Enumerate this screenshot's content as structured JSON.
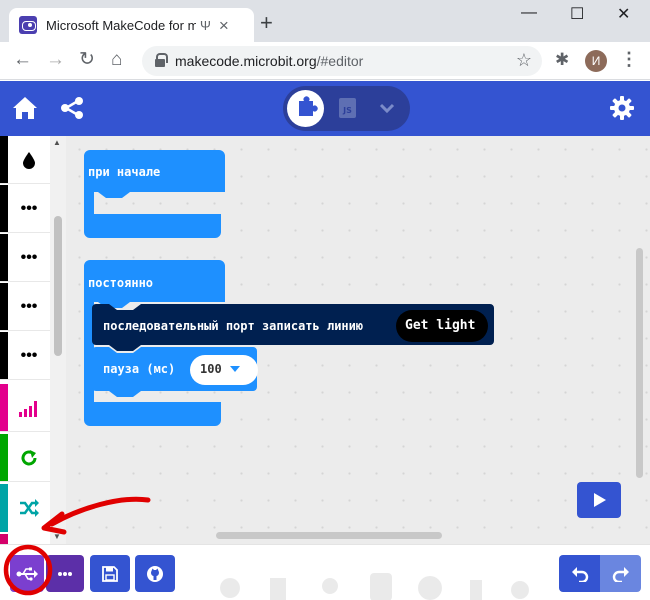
{
  "browser": {
    "tab_title": "Microsoft MakeCode for micro:bit",
    "tab_usb_glyph": "Ψ",
    "tab_close_glyph": "×",
    "new_tab_glyph": "+",
    "window_controls": {
      "minimize": "—",
      "maximize": "☐",
      "close": "✕"
    },
    "nav": {
      "back": "←",
      "forward": "→",
      "reload": "↻",
      "home": "⌂"
    },
    "url_host": "makecode.microbit.org",
    "url_path": "/#editor",
    "star_glyph": "☆",
    "extensions_glyph": "✱",
    "profile_initial": "И",
    "menu_glyph": "⋮"
  },
  "header": {
    "icons": [
      "home-icon",
      "share-icon",
      "gear-icon"
    ],
    "toggle": {
      "blocks_icon": "puzzle-icon",
      "js_label": "JS",
      "dropdown_icon": "chevron-down-icon"
    },
    "colors": {
      "header": "#3454d1",
      "toggle": "#2c3f9a"
    }
  },
  "toolbox": {
    "items": [
      {
        "icon": "drop-icon",
        "glyph": "●",
        "color": "#000000"
      },
      {
        "icon": "more-icon",
        "glyph": "•••",
        "color": "#000000"
      },
      {
        "icon": "more-icon",
        "glyph": "•••",
        "color": "#000000"
      },
      {
        "icon": "more-icon",
        "glyph": "•••",
        "color": "#000000"
      },
      {
        "icon": "more-icon",
        "glyph": "•••",
        "color": "#000000"
      },
      {
        "icon": "signal-icon",
        "glyph": "",
        "color": "#e3008c"
      },
      {
        "icon": "loop-icon",
        "glyph": "",
        "color": "#00a600"
      },
      {
        "icon": "shuffle-icon",
        "glyph": "",
        "color": "#00a4a6"
      }
    ]
  },
  "blocks": {
    "on_start": "при начале",
    "forever": "постоянно",
    "serial_write": "последовательный порт записать линию",
    "get_light": "Get light",
    "pause_label": "пауза (мс)",
    "pause_value": "100",
    "colors": {
      "basic": "#1e90ff",
      "serial": "#002050",
      "reporter": "#000000"
    }
  },
  "workspace": {
    "run_icon": "play-icon"
  },
  "bottombar": {
    "buttons": [
      {
        "name": "download-button",
        "icon": "usb-icon",
        "color": "#7b3fcf"
      },
      {
        "name": "more-button",
        "icon": "more-icon",
        "color": "#5c2fa8"
      },
      {
        "name": "save-button",
        "icon": "save-icon",
        "color": "#3454d1"
      },
      {
        "name": "github-button",
        "icon": "github-icon",
        "color": "#3454d1"
      },
      {
        "name": "undo-button",
        "icon": "undo-icon",
        "color": "#3454d1"
      },
      {
        "name": "redo-button",
        "icon": "redo-icon",
        "color": "#6a86e0"
      }
    ]
  },
  "annotation": {
    "color": "#e00000"
  }
}
